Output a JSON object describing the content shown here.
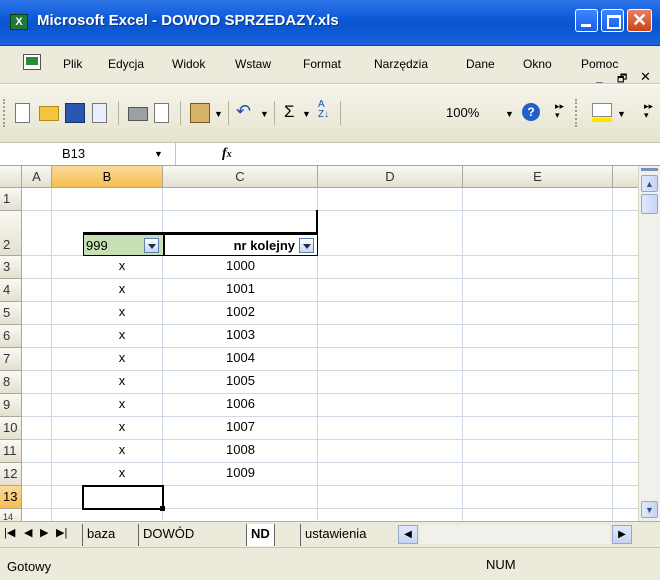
{
  "window": {
    "title": "Microsoft Excel - DOWOD SPRZEDAZY.xls"
  },
  "menu": {
    "items": [
      "Plik",
      "Edycja",
      "Widok",
      "Wstaw",
      "Format",
      "Narzędzia",
      "Dane",
      "Okno",
      "Pomoc"
    ]
  },
  "toolbar": {
    "zoom": "100%",
    "sum": "Σ"
  },
  "formula_bar": {
    "name_box": "B13",
    "fx": "fx",
    "value": ""
  },
  "grid": {
    "columns": [
      "A",
      "B",
      "C",
      "D",
      "E"
    ],
    "selected_column": "B",
    "selected_row": "13",
    "rows": [
      "1",
      "2",
      "3",
      "4",
      "5",
      "6",
      "7",
      "8",
      "9",
      "10",
      "11",
      "12",
      "13",
      "14"
    ],
    "header_row": {
      "b": "999",
      "c": "nr kolejny"
    },
    "data": [
      {
        "b": "x",
        "c": "1000"
      },
      {
        "b": "x",
        "c": "1001"
      },
      {
        "b": "x",
        "c": "1002"
      },
      {
        "b": "x",
        "c": "1003"
      },
      {
        "b": "x",
        "c": "1004"
      },
      {
        "b": "x",
        "c": "1005"
      },
      {
        "b": "x",
        "c": "1006"
      },
      {
        "b": "x",
        "c": "1007"
      },
      {
        "b": "x",
        "c": "1008"
      },
      {
        "b": "x",
        "c": "1009"
      }
    ]
  },
  "sheets": {
    "tabs": [
      "baza",
      "DOWÓD",
      "ND",
      "ustawienia"
    ],
    "active": "ND"
  },
  "status": {
    "left": "Gotowy",
    "right": "NUM"
  },
  "colors": {
    "selection_header": "#f6be52",
    "autofilter_cell": "#c6e0b4",
    "titlebar": "#0a58d6"
  }
}
